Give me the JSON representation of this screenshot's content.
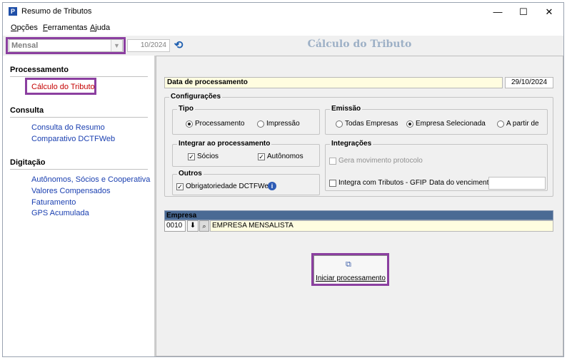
{
  "window": {
    "title": "Resumo de Tributos",
    "app_icon": "P",
    "minimize_glyph": "—",
    "maximize_glyph": "☐",
    "close_glyph": "✕"
  },
  "menu": {
    "opcoes_first": "O",
    "opcoes_rest": "pções",
    "ferramentas_first": "F",
    "ferramentas_rest": "erramentas",
    "ajuda_first": "A",
    "ajuda_rest": "juda"
  },
  "toolbar": {
    "combo_value": "Mensal",
    "period": "10/2024",
    "refresh_icon": "⟲"
  },
  "page_title": "Cálculo do Tributo",
  "sidebar": {
    "processamento": "Processamento",
    "calculo": "Cálculo do Tributo",
    "consulta": "Consulta",
    "consulta_resumo": "Consulta do Resumo",
    "comparativo": "Comparativo DCTFWeb",
    "digitacao": "Digitação",
    "autonomos": "Autônomos, Sócios e Cooperativa",
    "valores": "Valores Compensados",
    "faturamento": "Faturamento",
    "gps": "GPS Acumulada"
  },
  "form": {
    "data_label": "Data de processamento",
    "data_value": "29/10/2024",
    "config_title": "Configurações",
    "tipo_title": "Tipo",
    "tipo_processamento": "Processamento",
    "tipo_impressao": "Impressão",
    "emissao_title": "Emissão",
    "emissao_todas": "Todas Empresas",
    "emissao_selecionada": "Empresa Selecionada",
    "emissao_partir": "A partir de",
    "integrar_title": "Integrar ao processamento",
    "integrar_socios": "Sócios",
    "integrar_autonomos": "Autônomos",
    "integracoes_title": "Integrações",
    "gera_movimento": "Gera movimento protocolo",
    "integra_gfip": "Integra com Tributos - GFIP",
    "data_vencimento": "Data do vencimento",
    "outros_title": "Outros",
    "obrigatoriedade": "Obrigatoriedade DCTFWeb",
    "check_glyph": "✓",
    "info_glyph": "i"
  },
  "empresa": {
    "header": "Empresa",
    "code": "0010",
    "download_icon": "⬇",
    "find_icon": "⌕",
    "name": "EMPRESA MENSALISTA"
  },
  "action": {
    "start_label": "Iniciar processamento",
    "start_icon": "⧉"
  },
  "colors": {
    "highlight": "#8b3fa0",
    "active_link": "#c40000",
    "link": "#1a3fb0",
    "title_color": "#9db0c6"
  }
}
